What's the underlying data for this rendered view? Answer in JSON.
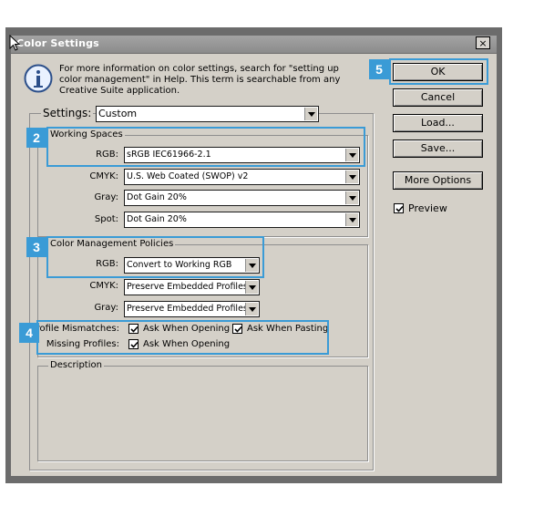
{
  "window": {
    "title": "Color Settings",
    "close_glyph": "×"
  },
  "info": {
    "icon": "info-icon",
    "line1": "For more information on color settings, search for \"setting up",
    "line2": "color management\" in Help. This term is searchable from any",
    "line3": "Creative Suite application."
  },
  "settings": {
    "label": "Settings:",
    "value": "Custom"
  },
  "working_spaces": {
    "title": "Working Spaces",
    "rgb_label": "RGB:",
    "rgb_value": "sRGB IEC61966-2.1",
    "cmyk_label": "CMYK:",
    "cmyk_value": "U.S. Web Coated (SWOP) v2",
    "gray_label": "Gray:",
    "gray_value": "Dot Gain 20%",
    "spot_label": "Spot:",
    "spot_value": "Dot Gain 20%"
  },
  "policies": {
    "title": "Color Management Policies",
    "rgb_label": "RGB:",
    "rgb_value": "Convert to Working RGB",
    "cmyk_label": "CMYK:",
    "cmyk_value": "Preserve Embedded Profiles",
    "gray_label": "Gray:",
    "gray_value": "Preserve Embedded Profiles",
    "mismatch_label": "Profile Mismatches:",
    "ask_opening": "Ask When Opening",
    "ask_pasting": "Ask When Pasting",
    "missing_label": "Missing Profiles:",
    "ask_opening_missing": "Ask When Opening"
  },
  "description": {
    "title": "Description"
  },
  "buttons": {
    "ok": "OK",
    "cancel": "Cancel",
    "load": "Load...",
    "save": "Save...",
    "more_options": "More Options",
    "preview": "Preview"
  },
  "badges": [
    "2",
    "3",
    "4",
    "5"
  ],
  "colors": {
    "highlight": "#3a9bd6",
    "dialog_bg": "#d4d0c8",
    "titlebar": "#8f8f8f"
  }
}
